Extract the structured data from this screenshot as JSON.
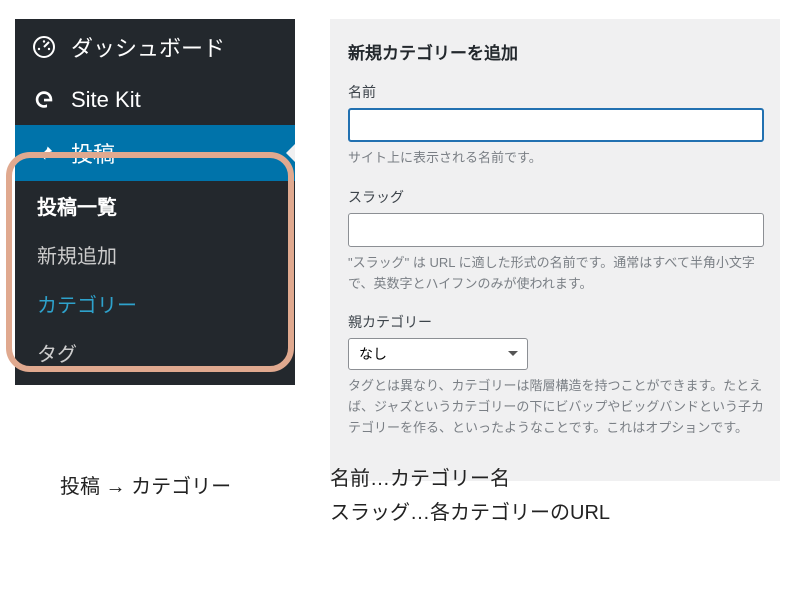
{
  "sidebar": {
    "items": [
      {
        "label": "ダッシュボード",
        "icon": "dashboard-icon"
      },
      {
        "label": "Site Kit",
        "icon": "sitekit-icon"
      },
      {
        "label": "投稿",
        "icon": "pin-icon",
        "active": true
      }
    ],
    "sub": [
      {
        "label": "投稿一覧"
      },
      {
        "label": "新規追加"
      },
      {
        "label": "カテゴリー"
      },
      {
        "label": "タグ"
      }
    ]
  },
  "form": {
    "heading": "新規カテゴリーを追加",
    "name": {
      "label": "名前",
      "value": "",
      "help": "サイト上に表示される名前です。"
    },
    "slug": {
      "label": "スラッグ",
      "value": "",
      "help": "\"スラッグ\" は URL に適した形式の名前です。通常はすべて半角小文字で、英数字とハイフンのみが使われます。"
    },
    "parent": {
      "label": "親カテゴリー",
      "selected": "なし",
      "help": "タグとは異なり、カテゴリーは階層構造を持つことができます。たとえば、ジャズというカテゴリーの下にビバップやビッグバンドという子カテゴリーを作る、といったようなことです。これはオプションです。"
    }
  },
  "captions": {
    "left": "投稿 →  カテゴリー",
    "right_line1": "名前…カテゴリー名",
    "right_line2": "スラッグ…各カテゴリーのURL"
  }
}
